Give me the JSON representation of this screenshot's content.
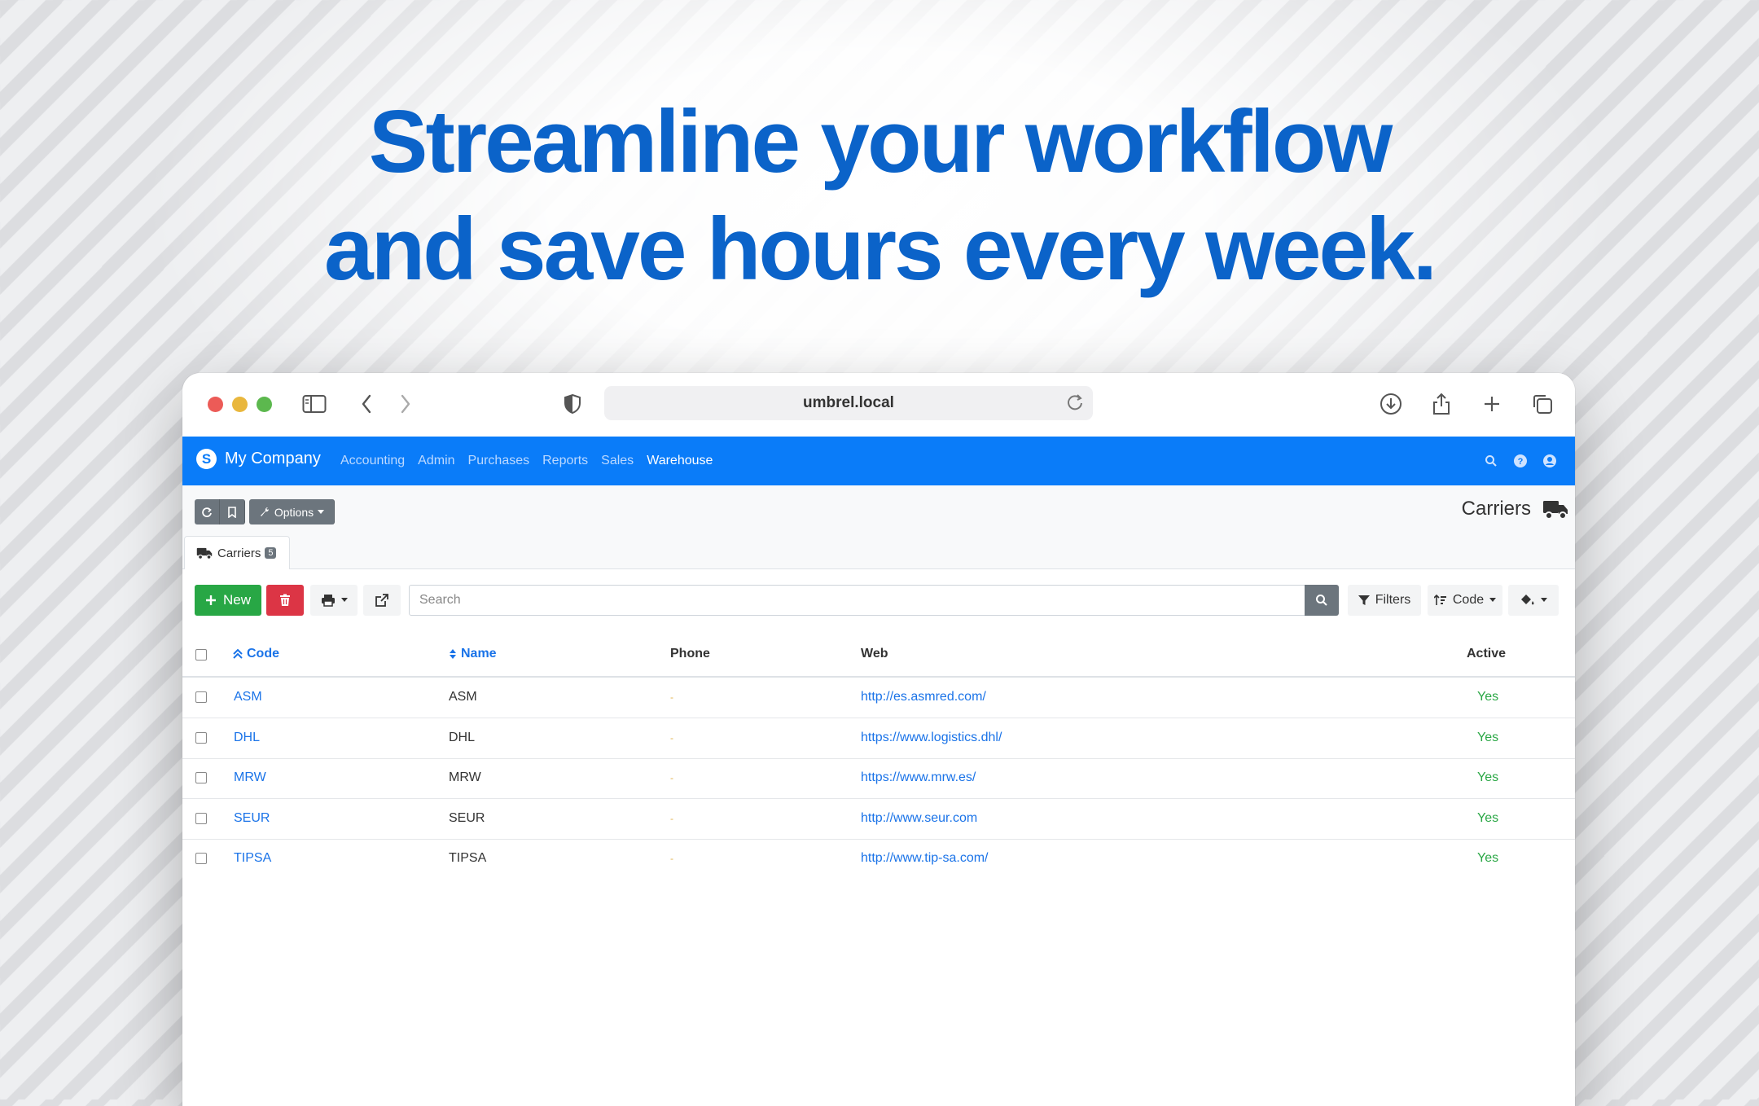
{
  "headline": {
    "line1": "Streamline your workflow",
    "line2": "and save hours every week."
  },
  "browser": {
    "url": "umbrel.local"
  },
  "navbar": {
    "brand": "My Company",
    "menu": [
      "Accounting",
      "Admin",
      "Purchases",
      "Reports",
      "Sales",
      "Warehouse"
    ],
    "active": "Warehouse"
  },
  "toolbar": {
    "options_label": "Options"
  },
  "page": {
    "title": "Carriers",
    "tab_label": "Carriers",
    "tab_count": "5"
  },
  "actions": {
    "new_label": "New",
    "search_placeholder": "Search",
    "filters_label": "Filters",
    "order_label": "Code"
  },
  "table": {
    "columns": [
      "Code",
      "Name",
      "Phone",
      "Web",
      "Active"
    ],
    "rows": [
      {
        "code": "ASM",
        "name": "ASM",
        "phone": "-",
        "web": "http://es.asmred.com/",
        "active": "Yes"
      },
      {
        "code": "DHL",
        "name": "DHL",
        "phone": "-",
        "web": "https://www.logistics.dhl/",
        "active": "Yes"
      },
      {
        "code": "MRW",
        "name": "MRW",
        "phone": "-",
        "web": "https://www.mrw.es/",
        "active": "Yes"
      },
      {
        "code": "SEUR",
        "name": "SEUR",
        "phone": "-",
        "web": "http://www.seur.com",
        "active": "Yes"
      },
      {
        "code": "TIPSA",
        "name": "TIPSA",
        "phone": "-",
        "web": "http://www.tip-sa.com/",
        "active": "Yes"
      }
    ]
  },
  "colors": {
    "headline": "#0b63c9",
    "navbar": "#0a7cf9",
    "success": "#28a745",
    "danger": "#dc3545",
    "secondary": "#6c757d"
  }
}
